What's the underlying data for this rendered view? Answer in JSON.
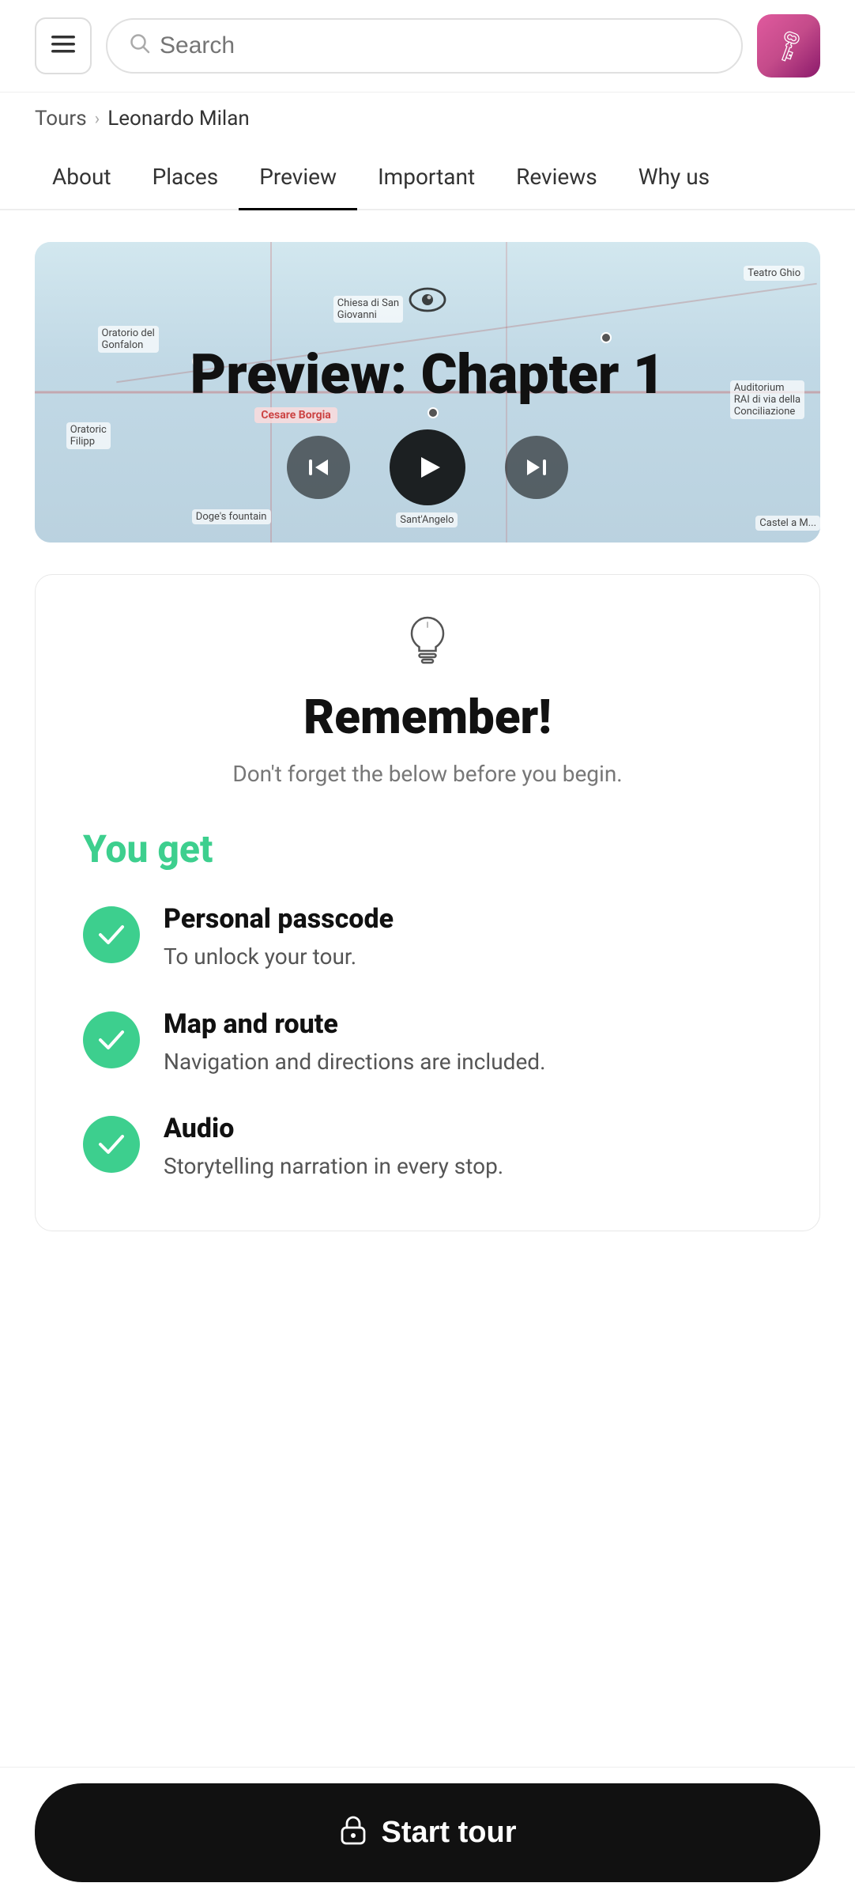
{
  "header": {
    "menu_label": "☰",
    "search_placeholder": "Search",
    "avatar_icon": "🗝"
  },
  "breadcrumb": {
    "root": "Tours",
    "separator": "›",
    "current": "Leonardo Milan"
  },
  "nav": {
    "tabs": [
      {
        "label": "About",
        "active": false
      },
      {
        "label": "Places",
        "active": false
      },
      {
        "label": "Preview",
        "active": true
      },
      {
        "label": "Important",
        "active": false
      },
      {
        "label": "Reviews",
        "active": false
      },
      {
        "label": "Why us",
        "active": false
      }
    ]
  },
  "preview": {
    "title": "Preview: Chapter 1",
    "eye_icon": "👁",
    "prev_icon": "⏮",
    "play_icon": "▶",
    "next_icon": "⏭"
  },
  "remember": {
    "icon": "💡",
    "title": "Remember!",
    "subtitle": "Don't forget the below before you begin.",
    "you_get_label": "You get",
    "features": [
      {
        "title": "Personal passcode",
        "desc": "To unlock your tour."
      },
      {
        "title": "Map and route",
        "desc": "Navigation and directions are included."
      },
      {
        "title": "Audio",
        "desc": "Storytelling narration in every stop."
      }
    ],
    "check_icon": "✓"
  },
  "cta": {
    "label": "Start tour",
    "lock_icon": "🔒"
  }
}
